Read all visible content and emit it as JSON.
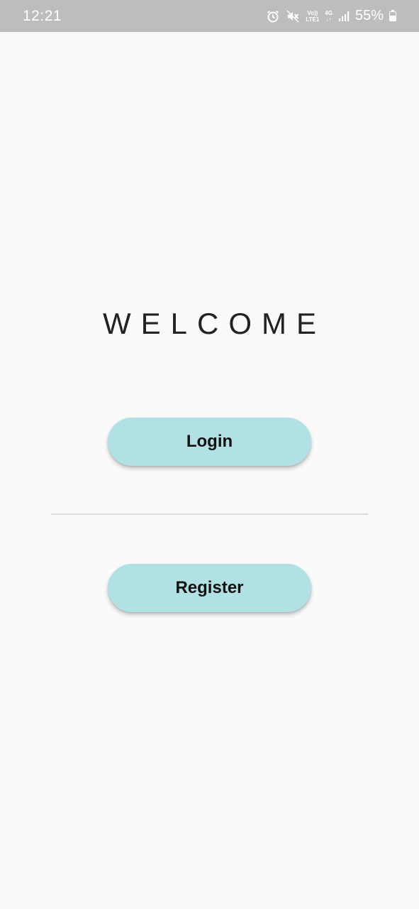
{
  "status_bar": {
    "time": "12:21",
    "volte_top": "Vo))",
    "volte_bottom": "LTE1",
    "network_top": "4G",
    "network_bottom": "↓↑",
    "battery_percent": "55%",
    "battery_level": 0.55,
    "icons": [
      "alarm-icon",
      "mute-icon",
      "volte-icon",
      "4g-icon",
      "signal-icon",
      "battery-icon"
    ]
  },
  "main": {
    "title": "WELCOME",
    "login_label": "Login",
    "register_label": "Register"
  },
  "colors": {
    "status_bar": "#bdbdbd",
    "background": "#fafafa",
    "button": "#b2e1e4",
    "divider": "#dcdcdc",
    "title_text": "#222222"
  }
}
